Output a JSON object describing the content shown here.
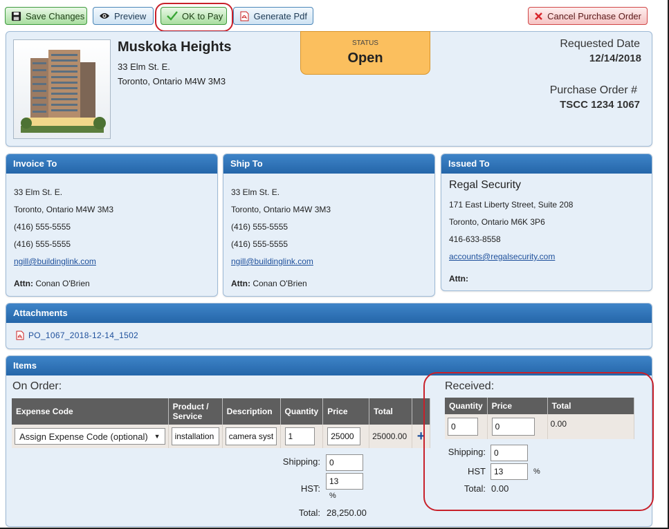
{
  "toolbar": {
    "save_label": "Save Changes",
    "preview_label": "Preview",
    "ok_to_pay_label": "OK to Pay",
    "generate_pdf_label": "Generate Pdf",
    "cancel_label": "Cancel Purchase Order"
  },
  "header": {
    "building_name": "Muskoka Heights",
    "address_line1": "33 Elm St. E.",
    "address_line2": "Toronto, Ontario M4W 3M3",
    "status_caption": "STATUS",
    "status_value": "Open",
    "requested_date_label": "Requested Date",
    "requested_date": "12/14/2018",
    "po_number_label": "Purchase Order #",
    "po_number": "TSCC 1234 1067"
  },
  "invoice_to": {
    "title": "Invoice To",
    "line1": "33 Elm St. E.",
    "line2": "Toronto, Ontario M4W 3M3",
    "phone1": "(416) 555-5555",
    "phone2": "(416) 555-5555",
    "email": "ngill@buildinglink.com",
    "attn_label": "Attn:",
    "attn_name": "Conan O'Brien"
  },
  "ship_to": {
    "title": "Ship To",
    "line1": "33 Elm St. E.",
    "line2": "Toronto, Ontario M4W 3M3",
    "phone1": "(416) 555-5555",
    "phone2": "(416) 555-5555",
    "email": "ngill@buildinglink.com",
    "attn_label": "Attn:",
    "attn_name": "Conan O'Brien"
  },
  "issued_to": {
    "title": "Issued To",
    "company": "Regal Security",
    "line1": "171 East Liberty Street, Suite 208",
    "line2": "Toronto, Ontario M6K 3P6",
    "phone": "416-633-8558",
    "email": "accounts@regalsecurity.com",
    "attn_label": "Attn:"
  },
  "attachments": {
    "title": "Attachments",
    "file_name": "PO_1067_2018-12-14_1502"
  },
  "items": {
    "title": "Items",
    "on_order_label": "On Order:",
    "columns": [
      "Expense Code",
      "Product / Service",
      "Description",
      "Quantity",
      "Price",
      "Total"
    ],
    "row": {
      "expense_code": "Assign Expense Code (optional)",
      "product": "installation",
      "description": "camera system",
      "quantity": "1",
      "price": "25000",
      "total": "25000.00"
    },
    "shipping_label": "Shipping:",
    "shipping_value": "0",
    "hst_label": "HST:",
    "hst_value": "13",
    "percent_sign": "%",
    "total_label": "Total:",
    "total_value": "28,250.00"
  },
  "received": {
    "label": "Received:",
    "columns": [
      "Quantity",
      "Price",
      "Total"
    ],
    "quantity": "0",
    "price": "0",
    "total": "0.00",
    "shipping_label": "Shipping:",
    "shipping_value": "0",
    "hst_label": "HST",
    "hst_value": "13",
    "percent_sign": "%",
    "total_label": "Total:",
    "total_value": "0.00"
  },
  "colors": {
    "panel_header": "#2f75ba",
    "status_bg": "#fbbf5e",
    "highlight_circle": "#c8202a"
  }
}
